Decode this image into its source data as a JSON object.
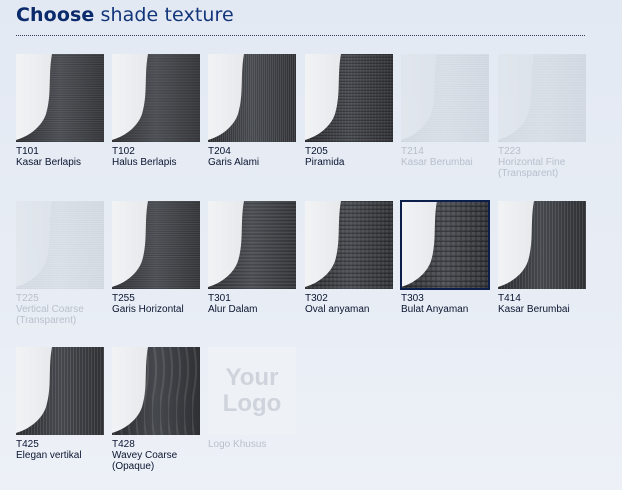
{
  "header": {
    "title_bold": "Choose",
    "title_light": "shade texture"
  },
  "textures": [
    {
      "code": "T101",
      "name": "Kasar Berlapis",
      "state": "normal",
      "pattern": "coarse-layer"
    },
    {
      "code": "T102",
      "name": "Halus Berlapis",
      "state": "normal",
      "pattern": "fine-layer"
    },
    {
      "code": "T204",
      "name": "Garis Alami",
      "state": "normal",
      "pattern": "natural-line"
    },
    {
      "code": "T205",
      "name": "Piramida",
      "state": "normal",
      "pattern": "pyramid"
    },
    {
      "code": "T214",
      "name": "Kasar Berumbai",
      "state": "disabled",
      "pattern": "light"
    },
    {
      "code": "T223",
      "name": "Horizontal Fine (Transparent)",
      "state": "disabled",
      "pattern": "light-horizontal"
    },
    {
      "code": "T225",
      "name": "Vertical Coarse (Transparent)",
      "state": "disabled",
      "pattern": "light"
    },
    {
      "code": "T255",
      "name": "Garis Horizontal",
      "state": "normal",
      "pattern": "horizontal"
    },
    {
      "code": "T301",
      "name": "Alur Dalam",
      "state": "normal",
      "pattern": "deep-groove"
    },
    {
      "code": "T302",
      "name": "Oval anyaman",
      "state": "normal",
      "pattern": "oval-weave"
    },
    {
      "code": "T303",
      "name": "Bulat Anyaman",
      "state": "selected",
      "pattern": "round-weave"
    },
    {
      "code": "T414",
      "name": "Kasar Berumbai",
      "state": "normal",
      "pattern": "fringe"
    },
    {
      "code": "T425",
      "name": "Elegan vertikal",
      "state": "normal",
      "pattern": "vertical"
    },
    {
      "code": "T428",
      "name": "Wavey Coarse (Opaque)",
      "state": "normal",
      "pattern": "wavey"
    }
  ],
  "custom_logo": {
    "logo_line1": "Your",
    "logo_line2": "Logo",
    "label": "Logo Khusus",
    "state": "disabled"
  }
}
